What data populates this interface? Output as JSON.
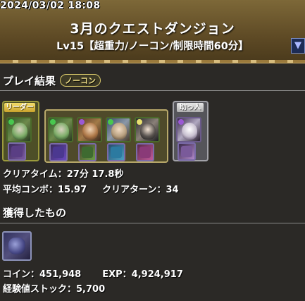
{
  "header": {
    "timestamp": "2024/03/02 18:08",
    "title": "3月のクエストダンジョン",
    "subtitle": "Lv15【超重力/ノーコン/制限時間60分】",
    "dropdown_icon": "triangle-down-icon"
  },
  "result": {
    "heading": "プレイ結果",
    "badge": "ノーコン",
    "leader_label": "リーダー",
    "helper_label": "助っ人",
    "stats": {
      "clear_time_label": "クリアタイム：",
      "clear_time_value": "27分 17.8秒",
      "avg_combo_label": "平均コンボ：",
      "avg_combo_value": "15.97",
      "clear_turn_label": "クリアターン：",
      "clear_turn_value": "34"
    }
  },
  "acquired": {
    "heading": "獲得したもの",
    "coin_label": "コイン：",
    "coin_value": "451,948",
    "exp_label": "EXP：",
    "exp_value": "4,924,917",
    "exp_stock_label": "経験値ストック：",
    "exp_stock_value": "5,700"
  },
  "colors": {
    "header_bg": "#6b5630",
    "panel_bg": "#2b2926",
    "leader_box": "#4d4f27",
    "team_box": "#4f4a2a",
    "helper_box": "#55555a"
  }
}
